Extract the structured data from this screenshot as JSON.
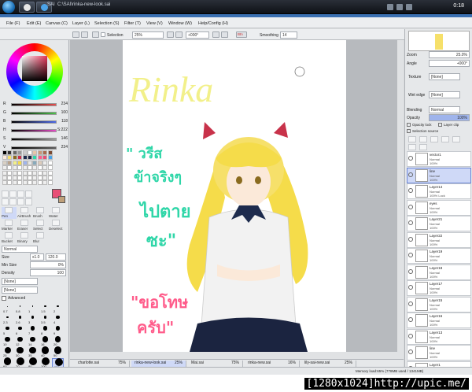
{
  "taskbar": {
    "window_title": "SAI",
    "doc_path": "C:\\SAI\\rinka-new-look.sai",
    "time": "0:18"
  },
  "menu": [
    {
      "label": "File (F)"
    },
    {
      "label": "Edit (E)"
    },
    {
      "label": "Canvas (C)"
    },
    {
      "label": "Layer (L)"
    },
    {
      "label": "Selection (S)"
    },
    {
      "label": "Filter (T)"
    },
    {
      "label": "View (V)"
    },
    {
      "label": "Window (W)"
    },
    {
      "label": "Help/Config (H)"
    }
  ],
  "toolbar": {
    "selection_label": "Selection",
    "zoom": "25%",
    "angle": "+000°",
    "stabilizer_btn": "Btn",
    "smoothing_label": "Smoothing",
    "smoothing_value": "14"
  },
  "color_sliders": [
    {
      "label": "R",
      "value": "234",
      "color": "#e84e4e"
    },
    {
      "label": "G",
      "value": "100",
      "color": "#4ec24e"
    },
    {
      "label": "B",
      "value": "118",
      "color": "#4e6be8"
    },
    {
      "label": "H",
      "value": "S:222",
      "color": "#e84ec9"
    },
    {
      "label": "S",
      "value": "146",
      "color": "#a0a0a0"
    },
    {
      "label": "V",
      "value": "234",
      "color": "#606060"
    }
  ],
  "tools": [
    {
      "label": "Pen"
    },
    {
      "label": "AirBrush"
    },
    {
      "label": "Brush"
    },
    {
      "label": "Water"
    },
    {
      "label": "Marker"
    },
    {
      "label": "Eraser"
    },
    {
      "label": "Select"
    },
    {
      "label": "Deselect"
    },
    {
      "label": "Bucket"
    },
    {
      "label": "Binary"
    },
    {
      "label": "Blur"
    }
  ],
  "tool_opts": {
    "mode": "Normal",
    "size_label": "Size",
    "size_mult": "x1.0",
    "size_value": "120.0",
    "min_label": "Min Size",
    "min_value": "0%",
    "density_label": "Density",
    "density_value": "100",
    "shape": "[None]",
    "texture": "[None]",
    "advanced": "Advanced"
  },
  "brush_sizes": [
    "0.7",
    "0.8",
    "1",
    "1.5",
    "2",
    "2.3",
    "2.6",
    "3",
    "3.5",
    "4",
    "5",
    "6",
    "7",
    "8",
    "9",
    "10",
    "12",
    "14",
    "16",
    "20",
    "25",
    "30",
    "35",
    "40",
    "50",
    "60",
    "70",
    "80",
    "100",
    "120"
  ],
  "navigator": {
    "zoom_label": "Zoom",
    "zoom": "25.0%",
    "angle_label": "Angle",
    "angle": "+000°"
  },
  "layer_props": {
    "texture_label": "Texture",
    "texture": "[None]",
    "wet_label": "Wet edge",
    "wet": "[None]",
    "blend_label": "Blending",
    "blend": "Normal",
    "opacity_label": "Opacity",
    "opacity": "100%",
    "protect": "Opacity lock",
    "clip": "Layer clip",
    "source": "Selection source"
  },
  "layers": [
    {
      "name": "vector1",
      "mode": "Normal",
      "opacity": "100%"
    },
    {
      "name": "line",
      "mode": "Normal",
      "opacity": "100%",
      "selected": true
    },
    {
      "name": "Layer14",
      "mode": "Normal",
      "opacity": "100% Lock"
    },
    {
      "name": "eyes",
      "mode": "Normal",
      "opacity": "100%"
    },
    {
      "name": "Layer21",
      "mode": "Normal",
      "opacity": "100%"
    },
    {
      "name": "Layer22",
      "mode": "Normal",
      "opacity": "100%"
    },
    {
      "name": "Layer19",
      "mode": "Normal",
      "opacity": "100%"
    },
    {
      "name": "Layer18",
      "mode": "Normal",
      "opacity": "100%"
    },
    {
      "name": "Layer17",
      "mode": "Normal",
      "opacity": "100%"
    },
    {
      "name": "Layer15",
      "mode": "Normal",
      "opacity": "100%"
    },
    {
      "name": "Layer16",
      "mode": "Normal",
      "opacity": "100%"
    },
    {
      "name": "Layer13",
      "mode": "Normal",
      "opacity": "100%"
    },
    {
      "name": "line",
      "mode": "Normal",
      "opacity": "100%"
    },
    {
      "name": "Layer1",
      "mode": "Normal",
      "opacity": "41%"
    }
  ],
  "doc_tabs": [
    {
      "name": "charlotte.sai",
      "zoom": "75%"
    },
    {
      "name": "rinka-new-look.sai",
      "zoom": "25%",
      "active": true
    },
    {
      "name": "Mai.sai",
      "zoom": "75%"
    },
    {
      "name": "rinka-new.sai",
      "zoom": "16%"
    },
    {
      "name": "lily-sai-new.sai",
      "zoom": "25%"
    }
  ],
  "status": {
    "memory": "Memory load:65% (778MB used / 1341MB)"
  },
  "artwork": {
    "title": "Rinka",
    "thai1": "\" วรีส ข้าจริงๆ ไปตาย ซะ\"",
    "thai2": "\"ขอโทษ ครับ\""
  },
  "footer": {
    "watermark": "[1280x1024]http://upic.me/"
  },
  "colors": {
    "accent": "#e84e76",
    "title": "#f2f08a",
    "thai_green": "#2fd6a8",
    "thai_pink": "#ff5b8a"
  }
}
